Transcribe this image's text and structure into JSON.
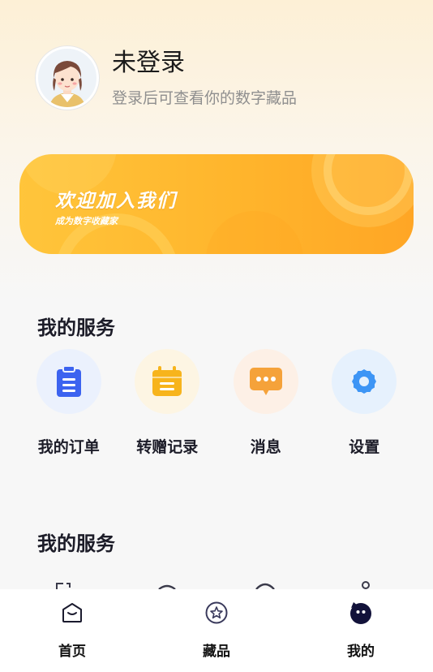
{
  "profile": {
    "title": "未登录",
    "subtitle": "登录后可查看你的数字藏品"
  },
  "banner": {
    "title": "欢迎加入我们",
    "subtitle": "成为数字收藏家"
  },
  "sections": [
    {
      "title": "我的服务",
      "items": [
        {
          "label": "我的订单",
          "icon": "clipboard-icon",
          "color": "#3c63f0"
        },
        {
          "label": "转赠记录",
          "icon": "calendar-icon",
          "color": "#f7b41c"
        },
        {
          "label": "消息",
          "icon": "message-icon",
          "color": "#f5a23a"
        },
        {
          "label": "设置",
          "icon": "gear-icon",
          "color": "#3d95f5"
        }
      ]
    },
    {
      "title": "我的服务"
    }
  ],
  "tabbar": {
    "items": [
      {
        "label": "首页",
        "icon": "home-icon"
      },
      {
        "label": "藏品",
        "icon": "star-icon"
      },
      {
        "label": "我的",
        "icon": "profile-icon",
        "active": true
      }
    ]
  }
}
